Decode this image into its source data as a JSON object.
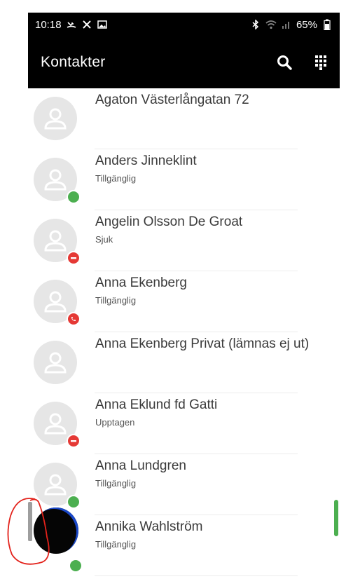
{
  "status_bar": {
    "time": "10:18",
    "battery": "65%",
    "left_icons": [
      "missed-call-icon",
      "tools-icon",
      "image-icon"
    ],
    "right_icons": [
      "bluetooth-icon",
      "wifi-icon",
      "signal-icon",
      "battery-icon"
    ]
  },
  "app_bar": {
    "title": "Kontakter",
    "actions": [
      "search-icon",
      "dialpad-icon"
    ]
  },
  "colors": {
    "available": "#4caf50",
    "busy": "#e53935",
    "on_call": "#e53935",
    "header_bg": "#000000",
    "scrollbar": "#4caf50"
  },
  "contacts": [
    {
      "name": "Agaton Västerlångatan 72",
      "status": "",
      "presence": "none"
    },
    {
      "name": "Anders Jinneklint",
      "status": "Tillgänglig",
      "presence": "available"
    },
    {
      "name": "Angelin Olsson De Groat",
      "status": "Sjuk",
      "presence": "busy"
    },
    {
      "name": "Anna Ekenberg",
      "status": "Tillgänglig",
      "presence": "on-call"
    },
    {
      "name": "Anna Ekenberg Privat (lämnas ej ut)",
      "status": "",
      "presence": "none"
    },
    {
      "name": "Anna Eklund fd Gatti",
      "status": "Upptagen",
      "presence": "busy"
    },
    {
      "name": "Anna Lundgren",
      "status": "Tillgänglig",
      "presence": "available"
    },
    {
      "name": "Annika Wahlström",
      "status": "Tillgänglig",
      "presence": "available"
    }
  ]
}
